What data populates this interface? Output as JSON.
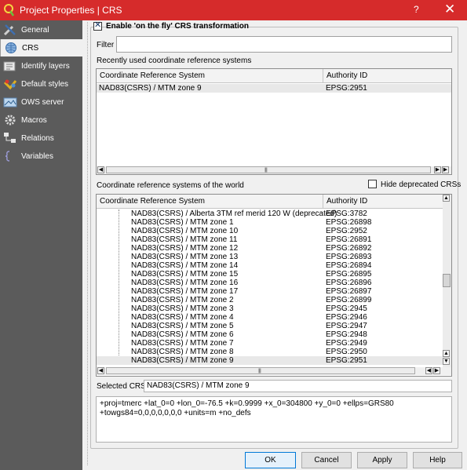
{
  "window": {
    "title": "Project Properties | CRS",
    "help_glyph": "?",
    "close_glyph": "✕"
  },
  "sidebar": {
    "items": [
      {
        "label": "General",
        "icon": "wrench-icon"
      },
      {
        "label": "CRS",
        "icon": "globe-icon"
      },
      {
        "label": "Identify layers",
        "icon": "identify-icon"
      },
      {
        "label": "Default styles",
        "icon": "styles-icon"
      },
      {
        "label": "OWS server",
        "icon": "ows-icon"
      },
      {
        "label": "Macros",
        "icon": "gear-icon"
      },
      {
        "label": "Relations",
        "icon": "relations-icon"
      },
      {
        "label": "Variables",
        "icon": "variables-icon"
      }
    ],
    "active_index": 1
  },
  "crs": {
    "enable_label": "Enable 'on the fly' CRS transformation",
    "enable_checked": true,
    "check_glyph": "✕",
    "filter_label": "Filter",
    "filter_value": "",
    "recent": {
      "label": "Recently used coordinate reference systems",
      "headers": [
        "Coordinate Reference System",
        "Authority ID"
      ],
      "rows": [
        {
          "crs": "NAD83(CSRS) / MTM zone 9",
          "auth": "EPSG:2951"
        }
      ]
    },
    "world": {
      "label": "Coordinate reference systems of the world",
      "hide_deprecated_label": "Hide deprecated CRSs",
      "hide_deprecated_checked": false,
      "headers": [
        "Coordinate Reference System",
        "Authority ID"
      ],
      "rows": [
        {
          "crs": "NAD83(CSRS) / Alberta 3TM ref merid 120 W (deprecated)",
          "auth": "EPSG:3782"
        },
        {
          "crs": "NAD83(CSRS) / MTM zone 1",
          "auth": "EPSG:26898"
        },
        {
          "crs": "NAD83(CSRS) / MTM zone 10",
          "auth": "EPSG:2952"
        },
        {
          "crs": "NAD83(CSRS) / MTM zone 11",
          "auth": "EPSG:26891"
        },
        {
          "crs": "NAD83(CSRS) / MTM zone 12",
          "auth": "EPSG:26892"
        },
        {
          "crs": "NAD83(CSRS) / MTM zone 13",
          "auth": "EPSG:26893"
        },
        {
          "crs": "NAD83(CSRS) / MTM zone 14",
          "auth": "EPSG:26894"
        },
        {
          "crs": "NAD83(CSRS) / MTM zone 15",
          "auth": "EPSG:26895"
        },
        {
          "crs": "NAD83(CSRS) / MTM zone 16",
          "auth": "EPSG:26896"
        },
        {
          "crs": "NAD83(CSRS) / MTM zone 17",
          "auth": "EPSG:26897"
        },
        {
          "crs": "NAD83(CSRS) / MTM zone 2",
          "auth": "EPSG:26899"
        },
        {
          "crs": "NAD83(CSRS) / MTM zone 3",
          "auth": "EPSG:2945"
        },
        {
          "crs": "NAD83(CSRS) / MTM zone 4",
          "auth": "EPSG:2946"
        },
        {
          "crs": "NAD83(CSRS) / MTM zone 5",
          "auth": "EPSG:2947"
        },
        {
          "crs": "NAD83(CSRS) / MTM zone 6",
          "auth": "EPSG:2948"
        },
        {
          "crs": "NAD83(CSRS) / MTM zone 7",
          "auth": "EPSG:2949"
        },
        {
          "crs": "NAD83(CSRS) / MTM zone 8",
          "auth": "EPSG:2950"
        },
        {
          "crs": "NAD83(CSRS) / MTM zone 9",
          "auth": "EPSG:2951"
        }
      ],
      "selected_index": 17
    },
    "selected_label": "Selected CRS:",
    "selected_value": "NAD83(CSRS) / MTM zone 9",
    "proj_string": "+proj=tmerc +lat_0=0 +lon_0=-76.5 +k=0.9999 +x_0=304800 +y_0=0 +ellps=GRS80 +towgs84=0,0,0,0,0,0,0 +units=m +no_defs"
  },
  "buttons": {
    "ok": "OK",
    "cancel": "Cancel",
    "apply": "Apply",
    "help": "Help"
  },
  "colors": {
    "titlebar": "#d62b2b",
    "sidebar": "#5b5b5b",
    "selection": "#e8e8e8",
    "default_button_border": "#0078d7"
  }
}
